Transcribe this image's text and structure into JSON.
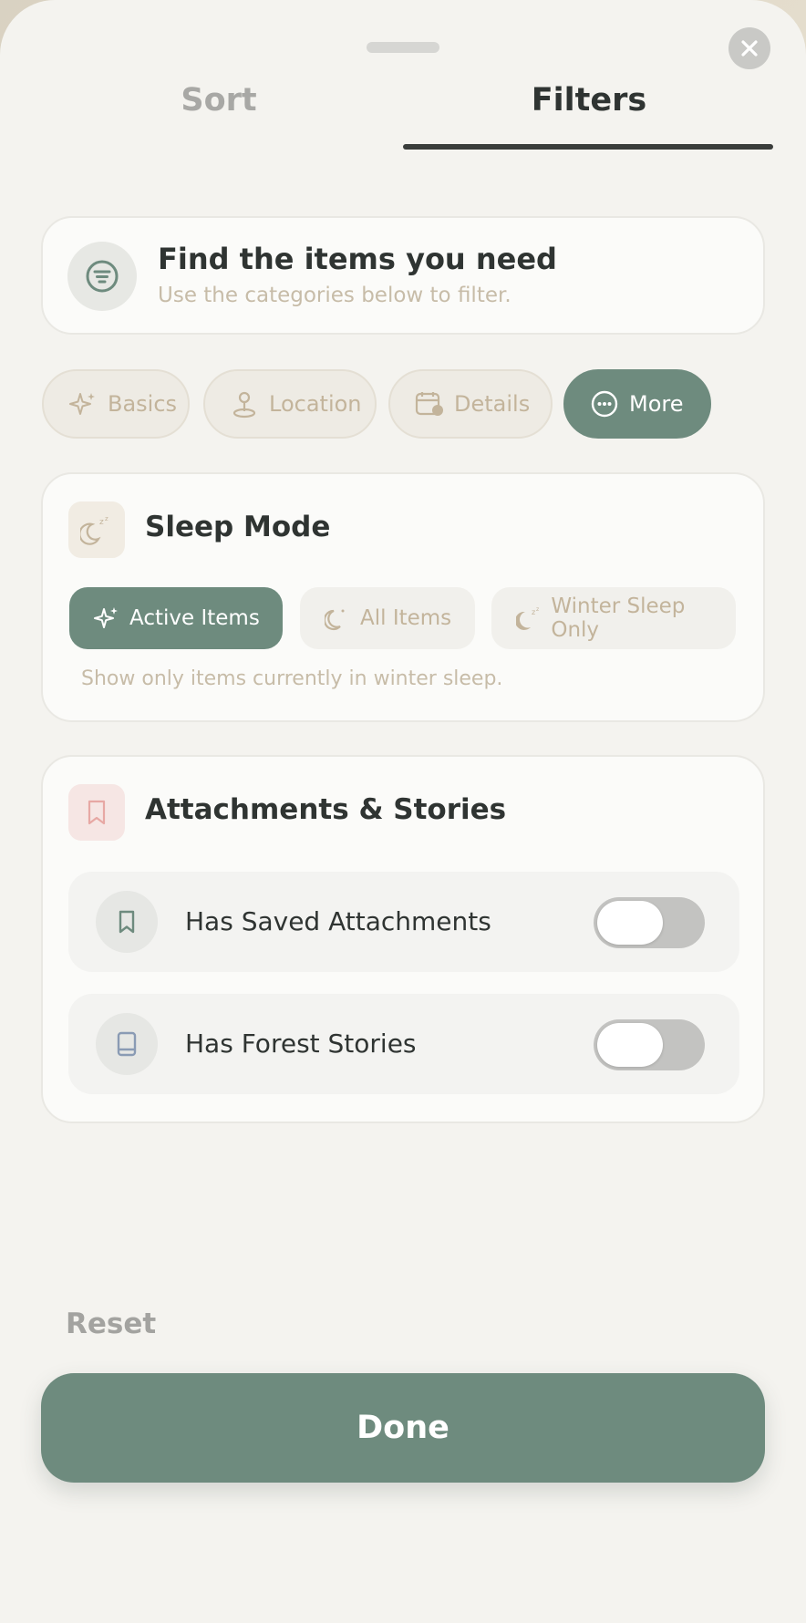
{
  "tabs": {
    "sort": "Sort",
    "filters": "Filters",
    "active": "Filters"
  },
  "intro": {
    "title": "Find the items you need",
    "subtitle": "Use the categories below to filter."
  },
  "categories": [
    {
      "label": "Basics",
      "icon": "sparkle-icon",
      "active": false
    },
    {
      "label": "Location",
      "icon": "pin-icon",
      "active": false
    },
    {
      "label": "Details",
      "icon": "calendar-icon",
      "active": false
    },
    {
      "label": "More",
      "icon": "more-icon",
      "active": true
    }
  ],
  "sleep_mode": {
    "title": "Sleep Mode",
    "options": [
      {
        "label": "Active Items",
        "icon": "sparkle-icon",
        "selected": true
      },
      {
        "label": "All Items",
        "icon": "moon-icon",
        "selected": false
      },
      {
        "label": "Winter Sleep Only",
        "icon": "moon-zzz-icon",
        "selected": false
      }
    ],
    "hint": "Show only items currently in winter sleep."
  },
  "attachments": {
    "title": "Attachments & Stories",
    "rows": [
      {
        "label": "Has Saved Attachments",
        "icon": "bookmark-icon",
        "enabled": false
      },
      {
        "label": "Has Forest Stories",
        "icon": "book-icon",
        "enabled": false
      }
    ]
  },
  "footer": {
    "reset": "Reset",
    "done": "Done"
  },
  "colors": {
    "accent": "#6e8b7e",
    "sheet": "#f4f3ef",
    "muted_text": "#c7bca8"
  }
}
